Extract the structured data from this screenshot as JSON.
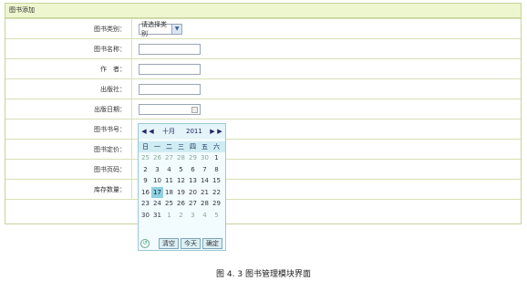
{
  "panel": {
    "title": "图书添加"
  },
  "form": {
    "category_label": "图书类别：",
    "category_value": "请选择类别",
    "name_label": "图书名称：",
    "author_label": "作　者：",
    "publisher_label": "出版社：",
    "pubdate_label": "出版日期：",
    "isbn_label": "图书书号：",
    "price_label": "图书定价：",
    "pages_label": "图书页码：",
    "stock_label": "库存数量："
  },
  "calendar": {
    "prev_year": "◀",
    "prev_month": "◀",
    "month": "十月",
    "year": "2011",
    "next_month": "▶",
    "next_year": "▶",
    "weekdays": [
      "日",
      "一",
      "二",
      "三",
      "四",
      "五",
      "六"
    ],
    "days": [
      [
        "25",
        "26",
        "27",
        "28",
        "29",
        "30",
        "1"
      ],
      [
        "2",
        "3",
        "4",
        "5",
        "6",
        "7",
        "8"
      ],
      [
        "9",
        "10",
        "11",
        "12",
        "13",
        "14",
        "15"
      ],
      [
        "16",
        "17",
        "18",
        "19",
        "20",
        "21",
        "22"
      ],
      [
        "23",
        "24",
        "25",
        "26",
        "27",
        "28",
        "29"
      ],
      [
        "30",
        "31",
        "1",
        "2",
        "3",
        "4",
        "5"
      ]
    ],
    "clear_btn": "清空",
    "today_btn": "今天",
    "ok_btn": "确定"
  },
  "caption": "图 4. 3  图书管理模块界面"
}
